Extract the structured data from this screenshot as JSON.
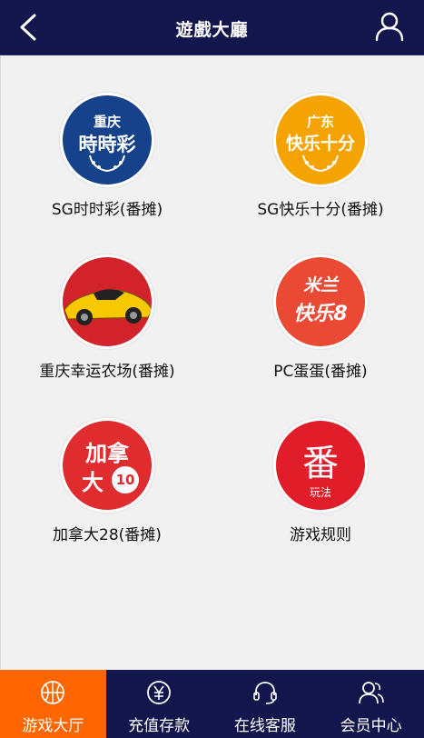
{
  "header": {
    "title": "遊戲大廳"
  },
  "games": [
    {
      "label": "SG时时彩(番摊)",
      "icon": "chongqing-ssc-icon",
      "icon_top": "重庆",
      "icon_main": "時時彩",
      "bg": "#16428b"
    },
    {
      "label": "SG快乐十分(番摊)",
      "icon": "guangdong-kl10-icon",
      "icon_top": "广东",
      "icon_main": "快乐十分",
      "bg": "#f5a300"
    },
    {
      "label": "重庆幸运农场(番摊)",
      "icon": "sports-car-icon",
      "bg": "#d2232a"
    },
    {
      "label": "PC蛋蛋(番摊)",
      "icon": "pc-egg-icon",
      "icon_top": "米兰",
      "icon_main": "快乐8",
      "bg": "#ea4a33"
    },
    {
      "label": "加拿大28(番摊)",
      "icon": "canada-28-icon",
      "icon_top": "加拿",
      "icon_main": "大",
      "icon_num": "10",
      "bg": "#e12c2f"
    },
    {
      "label": "游戏规则",
      "icon": "game-rules-icon",
      "icon_main": "番",
      "icon_sub": "玩法",
      "bg": "#e11d2a"
    }
  ],
  "tabs": [
    {
      "label": "游戏大厅",
      "icon": "basketball-icon",
      "active": true
    },
    {
      "label": "充值存款",
      "icon": "yen-coin-icon",
      "active": false
    },
    {
      "label": "在线客服",
      "icon": "headset-icon",
      "active": false
    },
    {
      "label": "会员中心",
      "icon": "members-icon",
      "active": false
    }
  ]
}
